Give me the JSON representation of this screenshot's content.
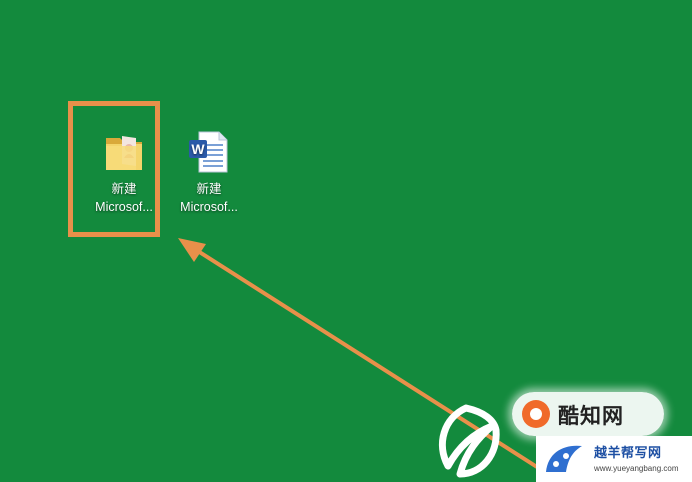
{
  "desktop": {
    "background_color": "#138a3d",
    "icons": [
      {
        "name": "folder-icon",
        "line1": "新建",
        "line2": "Microsof..."
      },
      {
        "name": "word-document-icon",
        "line1": "新建",
        "line2": "Microsof..."
      }
    ]
  },
  "annotation": {
    "highlight_color": "#e8904a",
    "arrow_color": "#e8904a"
  },
  "watermark": {
    "badge_text": "酷知网",
    "site_title": "越羊帮写网",
    "site_url": "www.yueyangbang.com"
  }
}
